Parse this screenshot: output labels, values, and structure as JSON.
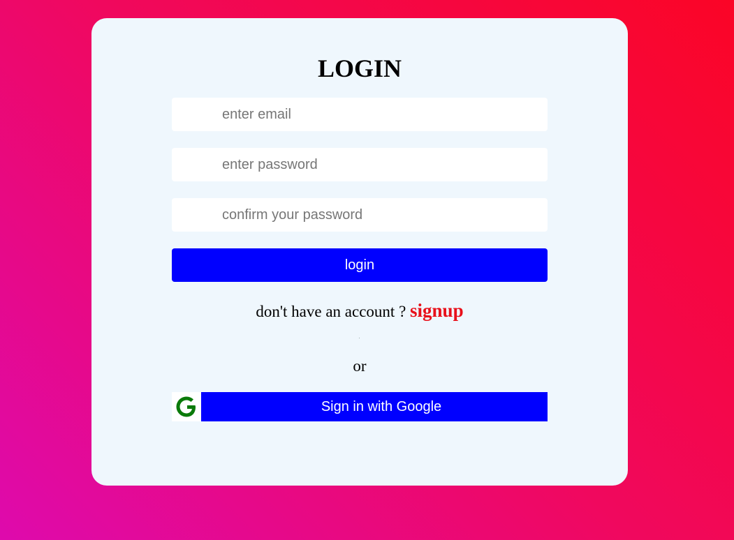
{
  "form": {
    "title": "LOGIN",
    "email_placeholder": "enter email",
    "password_placeholder": "enter password",
    "confirm_placeholder": "confirm your password",
    "login_label": "login",
    "account_prompt": "don't have an account ?",
    "signup_label": "signup",
    "or_label": "or",
    "google_label": "Sign in with Google",
    "google_icon": "google-g-icon"
  },
  "colors": {
    "background_gradient": [
      "#de0aad",
      "#f0085e",
      "#fb0526"
    ],
    "card": "#eff7fd",
    "button": "#0000ff",
    "signup": "#e8101a",
    "google_g": "#0a7a0a"
  }
}
